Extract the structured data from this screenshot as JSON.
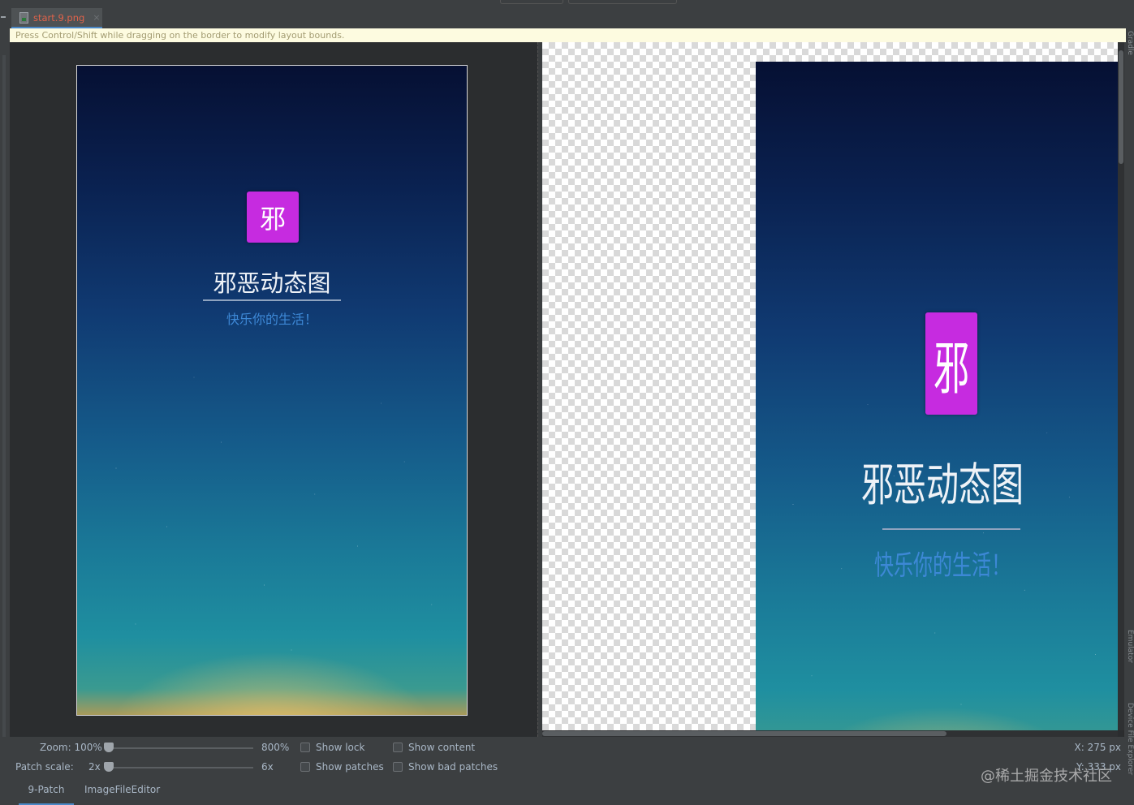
{
  "tab": {
    "filename": "start.9.png",
    "close": "×"
  },
  "hint": "Press Control/Shift while dragging on the border to modify layout bounds.",
  "poster": {
    "logo_char": "邪",
    "title": "邪恶动态图",
    "subtitle": "快乐你的生活！"
  },
  "right_rail": {
    "label_top": "Gradle",
    "label_mid": "Emulator",
    "label_bottom": "Device File Explorer"
  },
  "controls": {
    "zoom_label": "Zoom: 100%",
    "zoom_max": "800%",
    "zoom_value_percent": 100,
    "patch_scale_label": "Patch scale:",
    "patch_scale_value": "2x",
    "patch_scale_max": "6x",
    "show_lock": "Show lock",
    "show_content": "Show content",
    "show_patches": "Show patches",
    "show_bad_patches": "Show bad patches",
    "x_readout": "X: 275 px",
    "y_readout": "Y: 333 px"
  },
  "bottom_tabs": {
    "tab1": "9-Patch",
    "tab2": "ImageFileEditor",
    "active": "9-Patch"
  },
  "watermark": "@稀土掘金技术社区",
  "colors": {
    "logo_bg": "#c62be0",
    "accent": "#4a88c7",
    "tab_text": "#e0634a",
    "subtitle": "#3d88d6"
  }
}
